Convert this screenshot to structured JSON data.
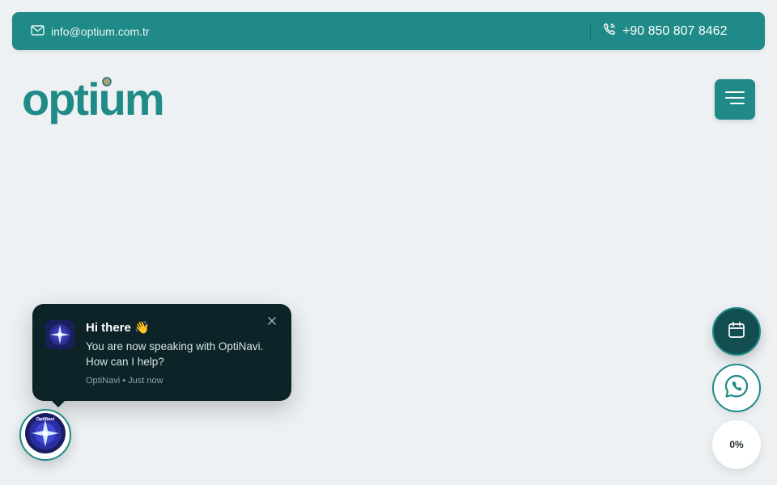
{
  "topbar": {
    "email": "info@optium.com.tr",
    "phone": "+90 850 807 8462",
    "email_icon": "mail-icon",
    "phone_icon": "phone-icon"
  },
  "header": {
    "logo_text": "optium",
    "menu_icon": "hamburger-menu-icon"
  },
  "chat": {
    "title": "Hi there 👋",
    "message": "You are now speaking with OptiNavi. How can I help?",
    "meta": "OptiNavi • Just now",
    "bot_name": "OptiNavi",
    "close_icon": "close-icon"
  },
  "floating": {
    "calendar_icon": "calendar-icon",
    "whatsapp_icon": "whatsapp-icon",
    "scroll_progress": "0%"
  },
  "colors": {
    "brand": "#1f8a87",
    "brand_dark": "#124e50",
    "background": "#edf1f3",
    "chat_bg": "#0c2328"
  }
}
